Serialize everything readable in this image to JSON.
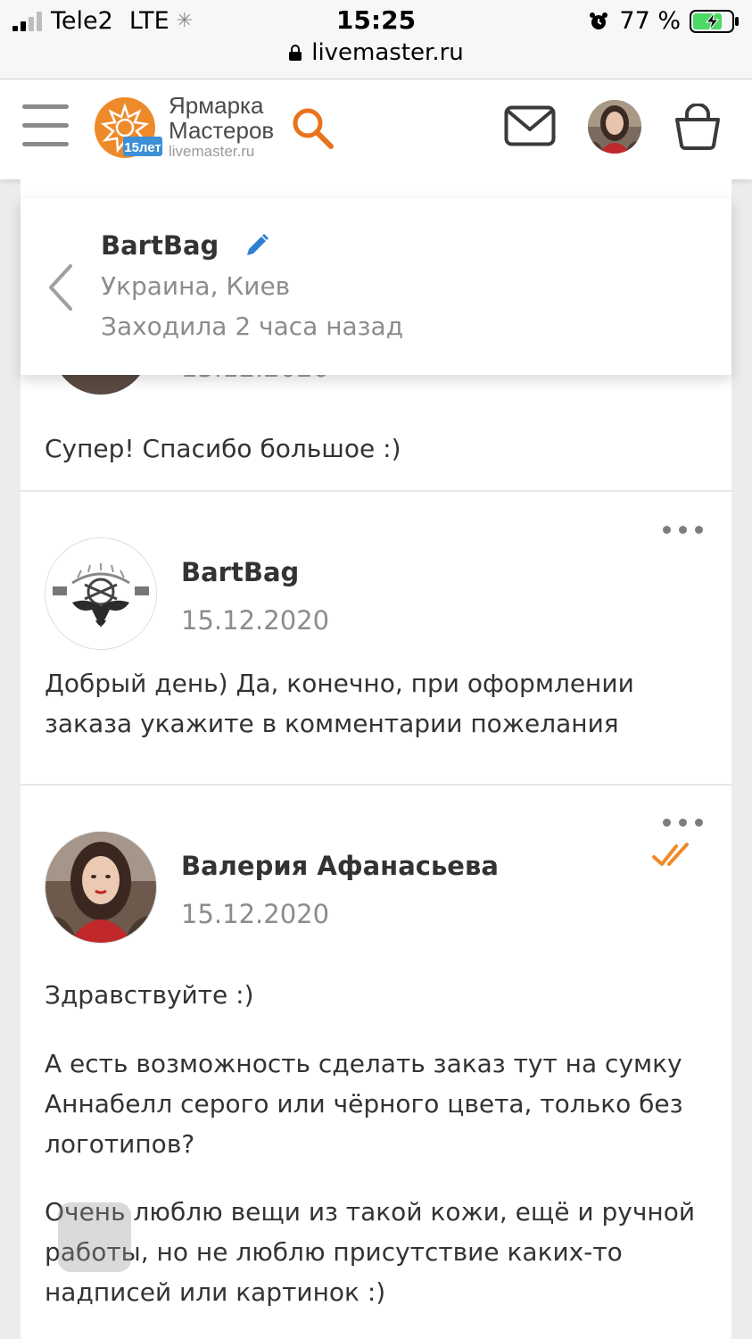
{
  "status_bar": {
    "carrier": "Tele2",
    "network": "LTE",
    "time": "15:25",
    "battery": "77 %",
    "url": "livemaster.ru"
  },
  "header": {
    "logo_line1": "Ярмарка",
    "logo_line2": "Мастеров",
    "logo_domain": "livemaster.ru",
    "logo_badge": "15лет",
    "icons": [
      "hamburger-icon",
      "search-icon",
      "mail-icon",
      "avatar",
      "cart-icon"
    ]
  },
  "conversation": {
    "name": "BartBag",
    "location": "Украина, Киев",
    "last_seen": "Заходила 2 часа назад"
  },
  "messages": [
    {
      "author": "",
      "date": "15.12.2020",
      "text": "Супер! Спасибо большое :)"
    },
    {
      "author": "BartBag",
      "date": "15.12.2020",
      "text": "Добрый день) Да, конечно, при оформлении заказа укажите в комментарии пожелания"
    },
    {
      "author": "Валерия Афанасьева",
      "date": "15.12.2020",
      "paragraphs": [
        "Здравствуйте :)",
        "А есть возможность сделать заказ тут на сумку Аннабелл серого или чёрного цвета, только без логотипов?",
        "Очень люблю вещи из такой кожи, ещё и ручной работы, но не люблю присутствие каких-то надписей или картинок :)"
      ]
    }
  ],
  "colors": {
    "accent_orange": "#e8731b",
    "edit_blue": "#2f7fd0",
    "background": "#ececec"
  }
}
